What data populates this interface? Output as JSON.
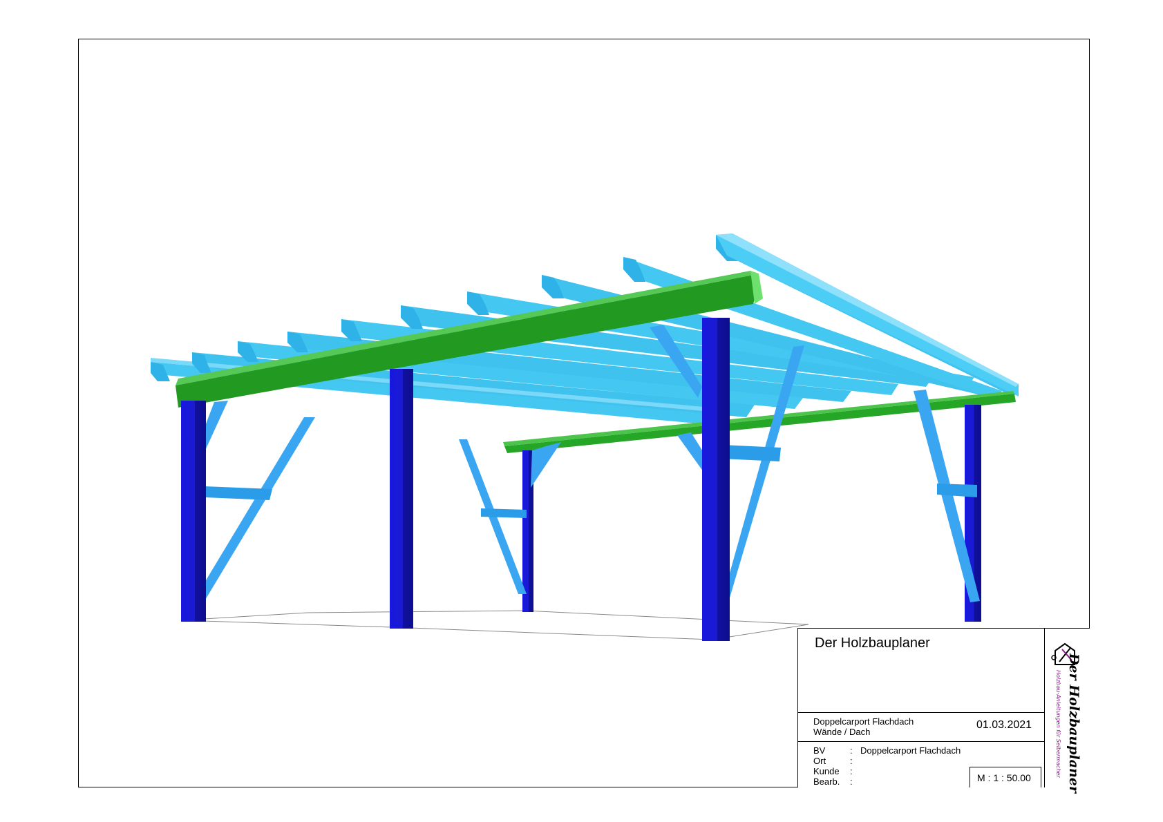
{
  "titleblock": {
    "company": "Der Holzbauplaner",
    "project_line1": "Doppelcarport Flachdach",
    "project_line2": "Wände / Dach",
    "date": "01.03.2021",
    "fields": [
      {
        "label": "BV",
        "value": "Doppelcarport Flachdach"
      },
      {
        "label": "Ort",
        "value": ""
      },
      {
        "label": "Kunde",
        "value": ""
      },
      {
        "label": "Bearb.",
        "value": ""
      }
    ],
    "scale": "M : 1 : 50.00"
  },
  "logo": {
    "title": "Der Holzbauplaner",
    "subtitle": "Holzbau-Anleitungen für Selbermacher",
    "icon": "house-pencil-logo-icon"
  },
  "colors": {
    "posts": "#1a1ad6",
    "rafters": "#2ec8f5",
    "beams": "#22a322",
    "braces": "#3aa0f0",
    "logo_accent": "#8b1a8b"
  }
}
